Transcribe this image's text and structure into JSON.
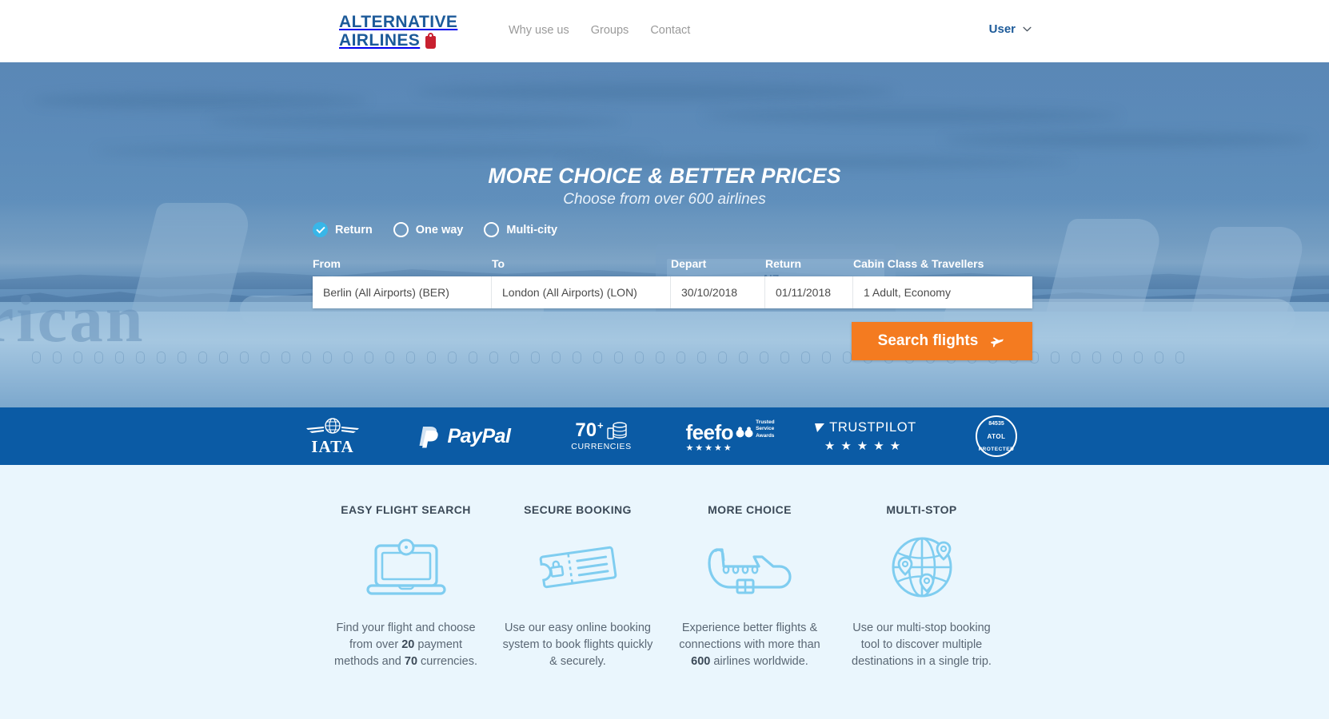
{
  "header": {
    "logo_line1": "ALTERNATIVE",
    "logo_line2": "AIRLINES",
    "nav": [
      {
        "label": "Why use us"
      },
      {
        "label": "Groups"
      },
      {
        "label": "Contact"
      }
    ],
    "user_label": "User"
  },
  "hero": {
    "headline_part1": "MORE CHOICE",
    "headline_amp": "&",
    "headline_part2": "BETTER PRICES",
    "subhead": "Choose from over 600 airlines",
    "trip_types": [
      {
        "label": "Return",
        "selected": true
      },
      {
        "label": "One way",
        "selected": false
      },
      {
        "label": "Multi-city",
        "selected": false
      }
    ],
    "form": {
      "label_from": "From",
      "label_to": "To",
      "label_depart": "Depart",
      "label_return": "Return",
      "label_cabin": "Cabin Class & Travellers",
      "value_from": "Berlin (All Airports) (BER)",
      "value_to": "London (All Airports) (LON)",
      "value_depart": "30/10/2018",
      "value_return": "01/11/2018",
      "value_cabin": "1 Adult, Economy",
      "placeholder_from": "From",
      "placeholder_to": "To"
    },
    "search_button": "Search flights",
    "search_button_icon": "airplane-icon",
    "accent_color": "#f47b20"
  },
  "trustbar": {
    "background": "#0b5ba5",
    "items": [
      {
        "name": "iata",
        "text": "IATA"
      },
      {
        "name": "paypal",
        "text": "PayPal"
      },
      {
        "name": "currencies",
        "number": "70",
        "sup": "+",
        "label": "CURRENCIES"
      },
      {
        "name": "feefo",
        "text": "feefo",
        "sub1": "Trusted",
        "sub2": "Service",
        "sub3": "Awards",
        "stars": "★★★★★"
      },
      {
        "name": "trustpilot",
        "text": "TRUSTPILOT",
        "stars": "★★★★★"
      },
      {
        "name": "atol",
        "number": "84535",
        "mid": "ATOL",
        "bottom": "PROTECTED"
      }
    ]
  },
  "features": [
    {
      "title": "EASY FLIGHT SEARCH",
      "icon": "laptop-icon",
      "desc_1": "Find your flight and choose from over ",
      "desc_b1": "20",
      "desc_2": " payment methods and ",
      "desc_b2": "70",
      "desc_3": " currencies."
    },
    {
      "title": "SECURE BOOKING",
      "icon": "ticket-lock-icon",
      "desc_1": "Use our easy online booking system to book flights quickly & securely.",
      "desc_b1": "",
      "desc_2": "",
      "desc_b2": "",
      "desc_3": ""
    },
    {
      "title": "MORE CHOICE",
      "icon": "airplane-icon",
      "desc_1": "Experience better flights & connections with more than ",
      "desc_b1": "600",
      "desc_2": " airlines worldwide.",
      "desc_b2": "",
      "desc_3": ""
    },
    {
      "title": "MULTI-STOP",
      "icon": "globe-pins-icon",
      "desc_1": "Use our multi-stop booking tool to discover multiple destinations in a single trip.",
      "desc_b1": "",
      "desc_2": "",
      "desc_b2": "",
      "desc_3": ""
    }
  ]
}
